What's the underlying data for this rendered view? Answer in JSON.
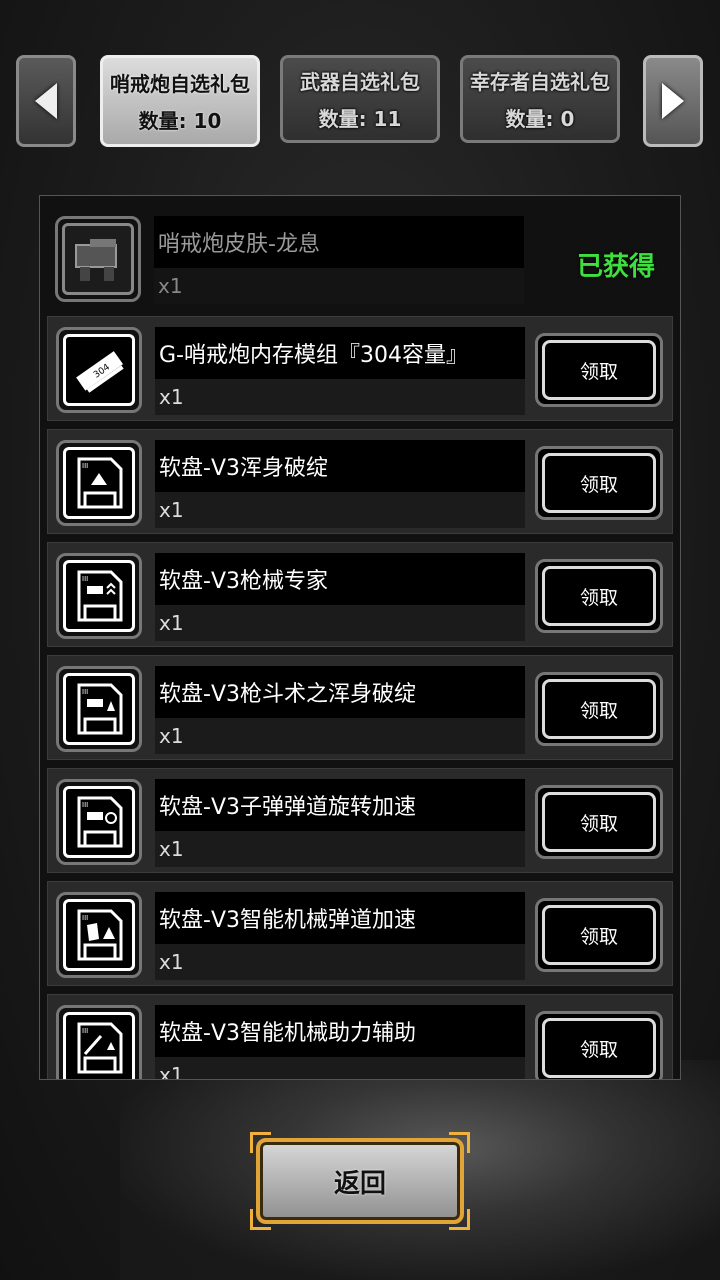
{
  "tabs": [
    {
      "name": "哨戒炮自选礼包",
      "count": "数量: 10",
      "active": true
    },
    {
      "name": "武器自选礼包",
      "count": "数量: 11",
      "active": false
    },
    {
      "name": "幸存者自选礼包",
      "count": "数量: 0",
      "active": false
    }
  ],
  "items": [
    {
      "name": "哨戒炮皮肤-龙息",
      "qty": "x1",
      "status": "已获得",
      "icon": "turret-skin-icon"
    },
    {
      "name": "G-哨戒炮内存模组『304容量』",
      "qty": "x1",
      "button": "领取",
      "icon": "memory-module-icon"
    },
    {
      "name": "软盘-V3浑身破绽",
      "qty": "x1",
      "button": "领取",
      "icon": "floppy-disk-icon"
    },
    {
      "name": "软盘-V3枪械专家",
      "qty": "x1",
      "button": "领取",
      "icon": "floppy-disk-icon"
    },
    {
      "name": "软盘-V3枪斗术之浑身破绽",
      "qty": "x1",
      "button": "领取",
      "icon": "floppy-disk-icon"
    },
    {
      "name": "软盘-V3子弹弹道旋转加速",
      "qty": "x1",
      "button": "领取",
      "icon": "floppy-disk-icon"
    },
    {
      "name": "软盘-V3智能机械弹道加速",
      "qty": "x1",
      "button": "领取",
      "icon": "floppy-disk-icon"
    },
    {
      "name": "软盘-V3智能机械助力辅助",
      "qty": "x1",
      "button": "领取",
      "icon": "floppy-disk-icon"
    }
  ],
  "back_label": "返回",
  "colors": {
    "obtained": "#3ee03e",
    "back_border": "#e1a437"
  }
}
